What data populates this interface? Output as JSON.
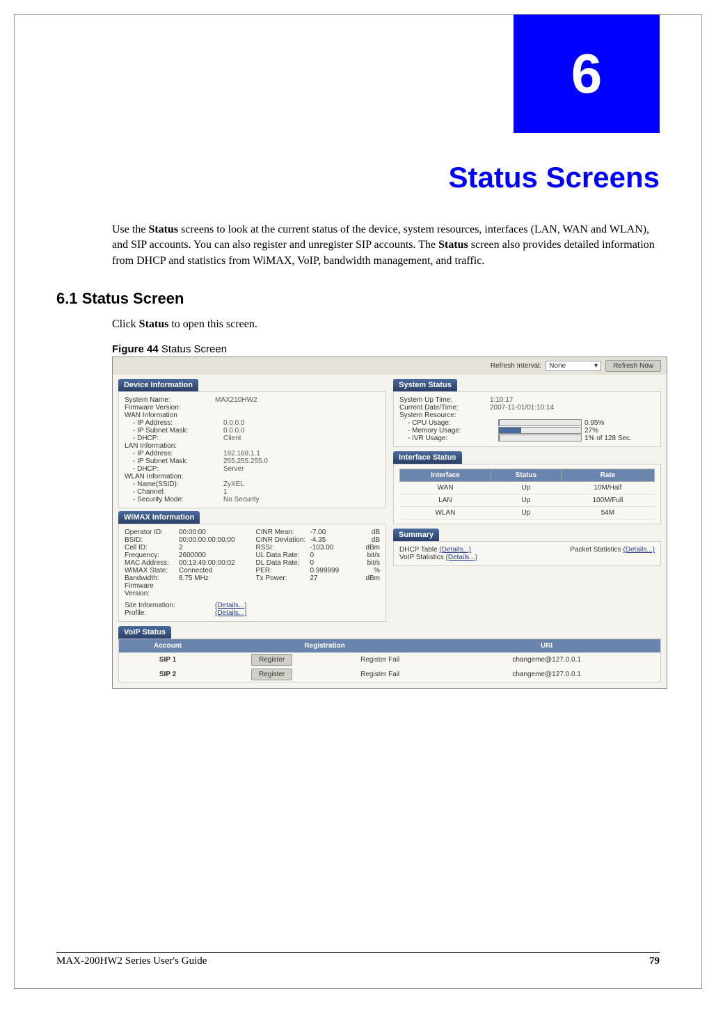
{
  "chapter": {
    "number": "6",
    "title": "Status Screens"
  },
  "intro": {
    "p1a": "Use the ",
    "p1b": "Status",
    "p1c": " screens to look at the current status of the device, system resources, interfaces (LAN, WAN and WLAN), and SIP accounts. You can also register and unregister SIP accounts. The ",
    "p1d": "Status",
    "p1e": " screen also provides detailed information from DHCP and statistics from WiMAX, VoIP, bandwidth management, and traffic."
  },
  "section61": {
    "heading": "6.1  Status Screen",
    "line_a": "Click ",
    "line_b": "Status",
    "line_c": " to open this screen."
  },
  "figure": {
    "label": "Figure 44",
    "caption": "   Status Screen"
  },
  "ss": {
    "top": {
      "refresh_interval_label": "Refresh Interval:",
      "interval_value": "None",
      "refresh_now": "Refresh Now"
    },
    "dev": {
      "title": "Device Information",
      "system_name_l": "System Name:",
      "system_name_v": "MAX210HW2",
      "fw_l": "Firmware Version:",
      "fw_v": "",
      "wan_l": "WAN Information",
      "wan_ip_l": "- IP Address:",
      "wan_ip_v": "0.0.0.0",
      "wan_sm_l": "- IP Subnet Mask:",
      "wan_sm_v": "0.0.0.0",
      "wan_dhcp_l": "- DHCP:",
      "wan_dhcp_v": "Client",
      "lan_l": "LAN Information:",
      "lan_ip_l": "- IP Address:",
      "lan_ip_v": "192.168.1.1",
      "lan_sm_l": "- IP Subnet Mask:",
      "lan_sm_v": "255.255.255.0",
      "lan_dhcp_l": "- DHCP:",
      "lan_dhcp_v": "Server",
      "wlan_l": "WLAN Information:",
      "wlan_ssid_l": "- Name(SSID):",
      "wlan_ssid_v": "ZyXEL",
      "wlan_ch_l": "- Channel:",
      "wlan_ch_v": "1",
      "wlan_sec_l": "- Security Mode:",
      "wlan_sec_v": "No Security"
    },
    "wimax": {
      "title": "WiMAX Information",
      "left": [
        {
          "l": "Operator ID:",
          "v": "00:00:00"
        },
        {
          "l": "BSID:",
          "v": "00:00:00:00:00:00"
        },
        {
          "l": "Cell ID:",
          "v": "2"
        },
        {
          "l": "Frequency:",
          "v": "2600000"
        },
        {
          "l": "MAC Address:",
          "v": "00:13:49:00:00:02"
        },
        {
          "l": "WiMAX State:",
          "v": "Connected"
        },
        {
          "l": "Bandwidth:",
          "v": "8.75 MHz"
        },
        {
          "l": "Firmware",
          "v": ""
        },
        {
          "l": "Version:",
          "v": ""
        }
      ],
      "right": [
        {
          "l": "CINR Mean:",
          "v": "-7.00",
          "u": "dB"
        },
        {
          "l": "CINR Deviation:",
          "v": "-4.35",
          "u": "dB"
        },
        {
          "l": "RSSI:",
          "v": "-103.00",
          "u": "dBm"
        },
        {
          "l": "UL Data Rate:",
          "v": "0",
          "u": "bit/s"
        },
        {
          "l": "DL Data Rate:",
          "v": "0",
          "u": "bit/s"
        },
        {
          "l": "PER:",
          "v": "0.999999",
          "u": "%"
        },
        {
          "l": "Tx Power:",
          "v": "27",
          "u": "dBm"
        }
      ],
      "site_l": "Site Information:",
      "site_link": "(Details...)",
      "profile_l": "Profile:",
      "profile_link": "(Details...)"
    },
    "sys": {
      "title": "System Status",
      "up_l": "System Up Time:",
      "up_v": "1:10:17",
      "dt_l": "Current Date/Time:",
      "dt_v": "2007-11-01/01:10:14",
      "res_l": "System Resource:",
      "cpu_l": "- CPU Usage:",
      "cpu_pct": 0.95,
      "cpu_v": "0.95%",
      "mem_l": "- Memory Usage:",
      "mem_pct": 27,
      "mem_v": "27%",
      "ivr_l": "- IVR Usage:",
      "ivr_pct": 1,
      "ivr_v": "1% of 128 Sec."
    },
    "iface": {
      "title": "Interface Status",
      "col1": "Interface",
      "col2": "Status",
      "col3": "Rate",
      "rows": [
        {
          "n": "WAN",
          "s": "Up",
          "r": "10M/Half"
        },
        {
          "n": "LAN",
          "s": "Up",
          "r": "100M/Full"
        },
        {
          "n": "WLAN",
          "s": "Up",
          "r": "54M"
        }
      ]
    },
    "summary": {
      "title": "Summary",
      "dhcp_l": "DHCP Table ",
      "dhcp_link": "(Details...)",
      "pkt_l": "Packet Statistics ",
      "pkt_link": "(Details...)",
      "voip_l": "VoIP Statistics ",
      "voip_link": "(Details...)"
    },
    "voip": {
      "title": "VoIP Status",
      "col1": "Account",
      "col2": "Registration",
      "col3": "URI",
      "reg_btn": "Register",
      "rows": [
        {
          "acct": "SIP 1",
          "status": "Register Fail",
          "uri": "changeme@127.0.0.1"
        },
        {
          "acct": "SIP 2",
          "status": "Register Fail",
          "uri": "changeme@127.0.0.1"
        }
      ]
    }
  },
  "footer": {
    "guide": "MAX-200HW2 Series User's Guide",
    "page": "79"
  }
}
